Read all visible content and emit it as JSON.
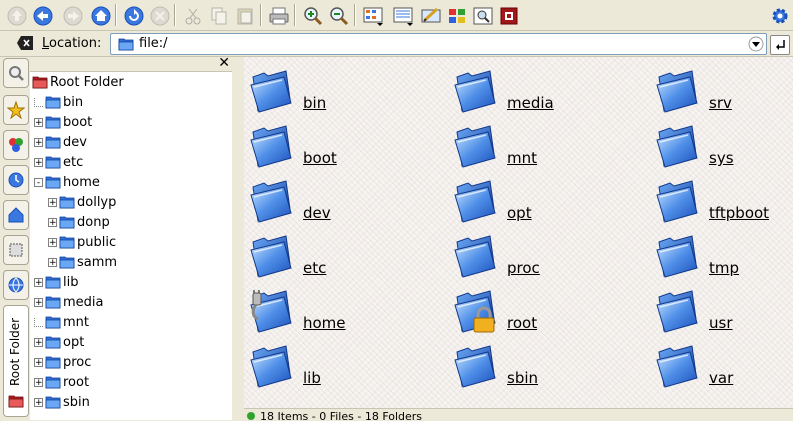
{
  "location": {
    "label": "Location:",
    "value": "file:/"
  },
  "toolbar": {
    "buttons": [
      "up-icon",
      "back-icon",
      "forward-icon",
      "home-icon",
      "reload-icon",
      "stop-icon",
      "cut-icon",
      "copy-icon",
      "paste-icon",
      "print-icon",
      "zoom-in-icon",
      "zoom-out-icon",
      "icon-view-icon",
      "detail-view-icon",
      "edit-icon",
      "windows-icon",
      "find-icon",
      "quit-icon",
      "settings-icon"
    ]
  },
  "sidebar_tab": {
    "label": "Root Folder"
  },
  "tree": {
    "root": "Root Folder",
    "items": [
      {
        "label": "bin",
        "expander": ""
      },
      {
        "label": "boot",
        "expander": "+"
      },
      {
        "label": "dev",
        "expander": "+"
      },
      {
        "label": "etc",
        "expander": "+"
      },
      {
        "label": "home",
        "expander": "−"
      },
      {
        "label": "dollyp",
        "expander": "+"
      },
      {
        "label": "donp",
        "expander": "+"
      },
      {
        "label": "public",
        "expander": "+"
      },
      {
        "label": "samm",
        "expander": "+"
      },
      {
        "label": "lib",
        "expander": "+"
      },
      {
        "label": "media",
        "expander": "+"
      },
      {
        "label": "mnt",
        "expander": ""
      },
      {
        "label": "opt",
        "expander": "+"
      },
      {
        "label": "proc",
        "expander": "+"
      },
      {
        "label": "root",
        "expander": "+"
      },
      {
        "label": "sbin",
        "expander": "+"
      }
    ]
  },
  "files": [
    {
      "name": "bin",
      "icon": "folder"
    },
    {
      "name": "media",
      "icon": "folder"
    },
    {
      "name": "srv",
      "icon": "folder"
    },
    {
      "name": "boot",
      "icon": "folder"
    },
    {
      "name": "mnt",
      "icon": "folder"
    },
    {
      "name": "sys",
      "icon": "folder"
    },
    {
      "name": "dev",
      "icon": "folder"
    },
    {
      "name": "opt",
      "icon": "folder"
    },
    {
      "name": "tftpboot",
      "icon": "folder"
    },
    {
      "name": "etc",
      "icon": "folder"
    },
    {
      "name": "proc",
      "icon": "folder"
    },
    {
      "name": "tmp",
      "icon": "folder"
    },
    {
      "name": "home",
      "icon": "home-folder"
    },
    {
      "name": "root",
      "icon": "locked-folder"
    },
    {
      "name": "usr",
      "icon": "folder"
    },
    {
      "name": "lib",
      "icon": "folder"
    },
    {
      "name": "sbin",
      "icon": "folder"
    },
    {
      "name": "var",
      "icon": "folder"
    }
  ],
  "status": {
    "text": "18 Items - 0 Files - 18 Folders"
  },
  "colors": {
    "folder_blue": "#2f6fd8",
    "folder_light": "#8fc3ff",
    "root_red": "#d83030"
  }
}
